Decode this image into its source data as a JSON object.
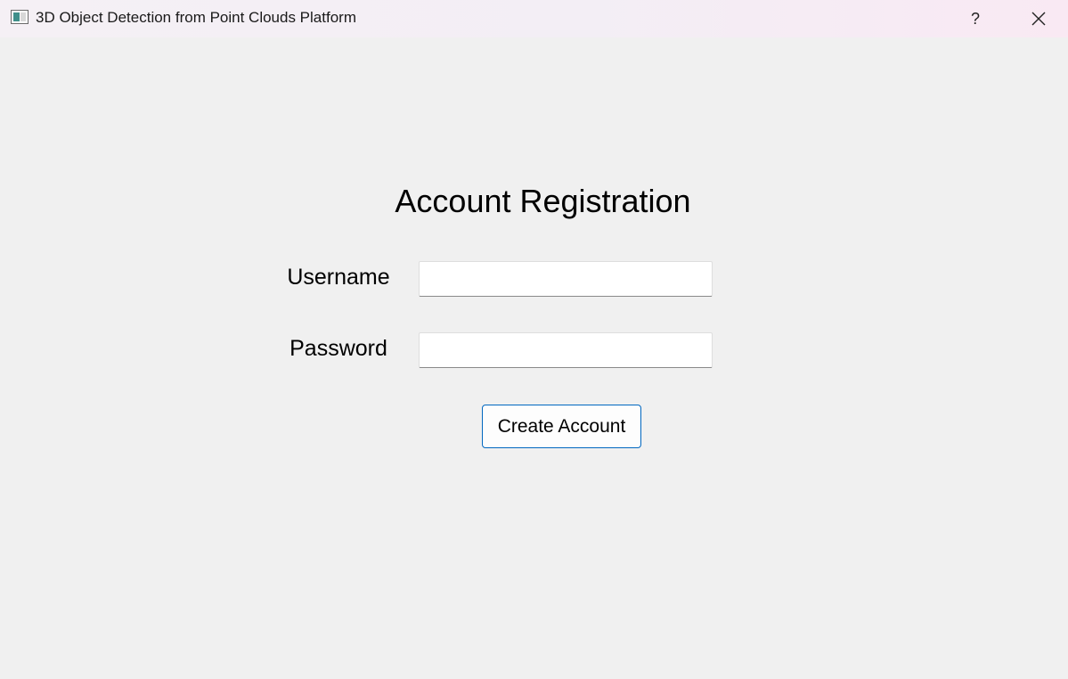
{
  "window": {
    "title": "3D Object Detection from Point Clouds Platform",
    "help_label": "?",
    "icons": {
      "app": "app-window-icon",
      "close": "close-icon"
    }
  },
  "form": {
    "heading": "Account Registration",
    "username_label": "Username",
    "username_value": "",
    "password_label": "Password",
    "password_value": "",
    "submit_label": "Create Account"
  },
  "colors": {
    "background": "#f0f0f0",
    "accent_border": "#0067c0",
    "field_background": "#ffffff"
  }
}
